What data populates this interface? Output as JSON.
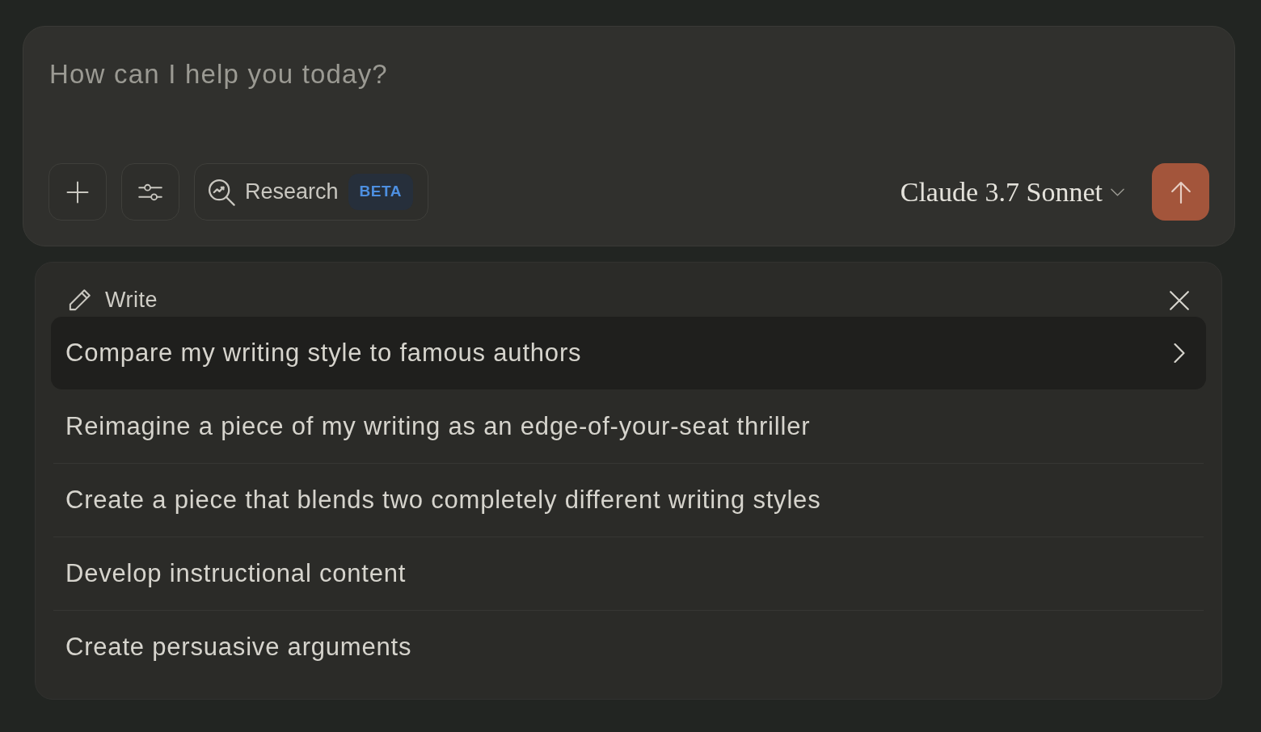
{
  "composer": {
    "placeholder": "How can I help you today?",
    "research": {
      "label": "Research",
      "badge": "BETA"
    },
    "model_picker": {
      "label": "Claude 3.7 Sonnet"
    }
  },
  "suggestions": {
    "category": "Write",
    "items": [
      {
        "text": "Compare my writing style to famous authors",
        "selected": true
      },
      {
        "text": "Reimagine a piece of my writing as an edge-of-your-seat thriller",
        "selected": false
      },
      {
        "text": "Create a piece that blends two completely different writing styles",
        "selected": false
      },
      {
        "text": "Develop instructional content",
        "selected": false
      },
      {
        "text": "Create persuasive arguments",
        "selected": false
      }
    ]
  }
}
